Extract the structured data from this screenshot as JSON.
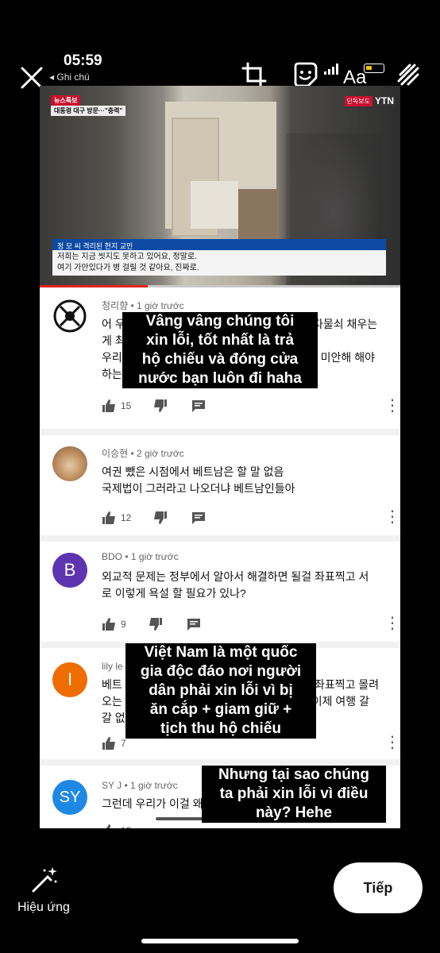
{
  "status": {
    "time": "05:59",
    "back_label": "◂ Ghi chú"
  },
  "toolbar": {
    "text_label": "Aa"
  },
  "video": {
    "news_tag": "뉴스특보",
    "headline": "대통령 대구 방문···\"충력\"",
    "exclusive_tag": "단독보도",
    "channel": "YTN",
    "caption_name": "정 모 씨  격리된 현지 교민",
    "caption_line1": "저희는 지금 씻지도 못하고 있어요, 정말로.",
    "caption_line2": "여기 가만있다가 병 걸릴 것 같아요, 진짜로.",
    "progress": 0.3
  },
  "comments": [
    {
      "author": "청리향",
      "time": "1 giờ trước",
      "lines": [
        "어 우",
        "게 최",
        "우리",
        "하는"
      ],
      "right_fragments": [
        "자물쇠 채우는",
        "? 미안해 해야"
      ],
      "likes": "15",
      "avatar_letter": "",
      "avatar_color": "#ffffff"
    },
    {
      "author": "이승현",
      "time": "2 giờ trước",
      "lines": [
        "여권 뺐은 시점에서 베트남은 할 말 없음",
        "국제법이 그러라고 나오더냐 베트남인들아"
      ],
      "likes": "12",
      "avatar_letter": "",
      "avatar_color": "#b98a5c"
    },
    {
      "author": "BDO",
      "time": "1 giờ trước",
      "lines": [
        "외교적 문제는 정부에서 알아서 해결하면 될걸 좌표찍고 서",
        "로 이렇게 욕설 할 필요가 있나?"
      ],
      "likes": "9",
      "avatar_letter": "B",
      "avatar_color": "#5e35b1"
    },
    {
      "author": "lily le",
      "time": "",
      "lines": [
        "베트",
        "오는 베",
        "갈 없다"
      ],
      "right_fragments": [
        "좌표찍고 몰려",
        "남 이제 여행 갈"
      ],
      "likes": "7",
      "avatar_letter": "I",
      "avatar_color": "#ef6c00"
    },
    {
      "author": "SY J",
      "time": "1 giờ trước",
      "lines": [
        "그런데 우리가 이걸 왜"
      ],
      "likes": "13",
      "avatar_letter": "SY",
      "avatar_color": "#1e88e5"
    }
  ],
  "captions": {
    "cap1": [
      "Vâng vâng chúng tôi",
      "xin lỗi, tốt nhất là trả",
      "hộ chiếu và đóng cửa",
      "nước bạn luôn đi haha"
    ],
    "cap2": [
      "Việt Nam là một quốc",
      "gia độc đáo nơi người",
      "dân phải xin lỗi vì bị",
      "ăn cắp + giam giữ +",
      "tịch thu hộ chiếu"
    ],
    "cap3": [
      "Nhưng tại sao chúng",
      "ta phải xin lỗi vì điều",
      "này? Hehe"
    ]
  },
  "bottom": {
    "effects_label": "Hiệu ứng",
    "next_label": "Tiếp"
  }
}
